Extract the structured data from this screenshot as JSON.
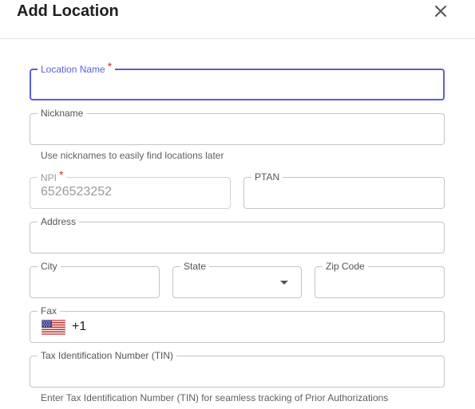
{
  "header": {
    "title": "Add Location",
    "close_icon": "close-icon"
  },
  "fields": {
    "location_name": {
      "label": "Location Name",
      "required_mark": "*",
      "value": ""
    },
    "nickname": {
      "label": "Nickname",
      "value": "",
      "helper": "Use nicknames to easily find locations later"
    },
    "npi": {
      "label": "NPI",
      "required_mark": "*",
      "value": "6526523252"
    },
    "ptan": {
      "label": "PTAN",
      "value": ""
    },
    "address": {
      "label": "Address",
      "value": ""
    },
    "city": {
      "label": "City",
      "value": ""
    },
    "state": {
      "label": "State",
      "value": "",
      "icon": "dropdown-caret-icon"
    },
    "zip": {
      "label": "Zip Code",
      "value": ""
    },
    "fax": {
      "label": "Fax",
      "country_icon": "us-flag-icon",
      "dial_code": "+1"
    },
    "tin": {
      "label": "Tax Identification Number (TIN)",
      "value": "",
      "helper": "Enter Tax Identification Number (TIN) for seamless tracking of Prior Authorizations"
    }
  },
  "colors": {
    "focus": "#5a5fd6",
    "required": "#d32f2f",
    "border": "#c4c4c4"
  }
}
